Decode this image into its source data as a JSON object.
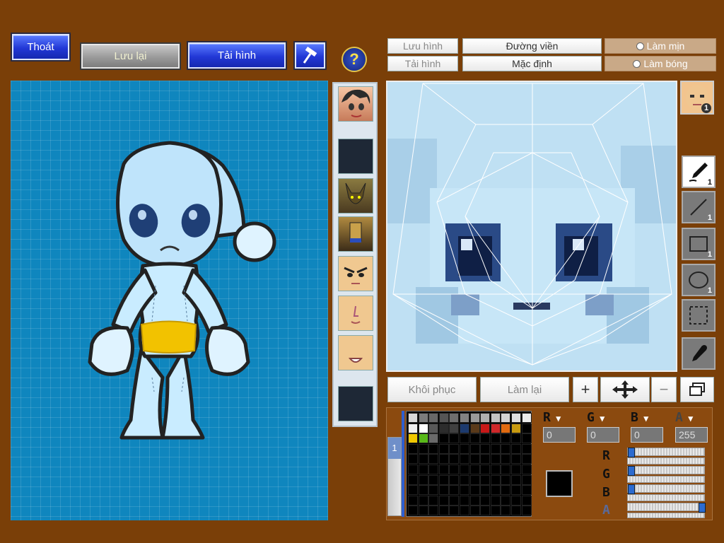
{
  "top_buttons": {
    "exit_label": "Thoát",
    "save_label": "Lưu lại",
    "reload_label": "Tải hình",
    "help_symbol": "?"
  },
  "editor_tabs": {
    "save_image_label": "Lưu hình",
    "reload_image_label": "Tải hình",
    "outline_label": "Đường viền",
    "default_label": "Mặc định",
    "smooth_label": "Làm mịn",
    "shine_label": "Làm bóng"
  },
  "tool_counts": {
    "face_badge": "1",
    "pen": "1",
    "line": "1",
    "rect": "1",
    "ellipse": "1"
  },
  "action_buttons": {
    "restore_label": "Khôi phục",
    "redo_label": "Làm lại",
    "zoom_in_symbol": "+",
    "zoom_out_symbol": "−"
  },
  "color": {
    "r_label": "R",
    "g_label": "G",
    "b_label": "B",
    "a_label": "A",
    "r_value": "0",
    "g_value": "0",
    "b_value": "0",
    "a_value": "255",
    "current": "#000000",
    "palette_row1": [
      "#d8d8d8",
      "#7c7c7c",
      "#686868",
      "#555555",
      "#6e6e6e",
      "#828282",
      "#9a9a9a",
      "#b0b0b0",
      "#c4c4c4",
      "#d4d4d4",
      "#e0e0e0",
      "#ececec"
    ],
    "palette_row2": [
      "#f0f0f0",
      "#ffffff",
      "#585858",
      "#2c2c2c",
      "#404040",
      "#1c3a6e",
      "#5a3a1a",
      "#c81818",
      "#d0282a",
      "#e06a10",
      "#c89a10",
      "#000000"
    ],
    "palette_row3": [
      "#f0c800",
      "#58b818",
      "#6a6a6a",
      "#000000",
      "#000000",
      "#000000",
      "#000000",
      "#000000",
      "#000000",
      "#000000",
      "#000000",
      "#000000"
    ],
    "page_tab": "1"
  }
}
